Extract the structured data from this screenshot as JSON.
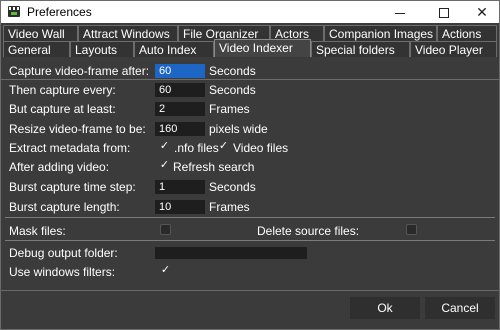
{
  "window": {
    "title": "Preferences"
  },
  "tabs_row1": [
    "Video Wall",
    "Attract Windows",
    "File Organizer",
    "Actors",
    "Companion Images",
    "Actions"
  ],
  "tabs_row2": [
    "General",
    "Layouts",
    "Auto Index",
    "Video Indexer",
    "Special folders",
    "Video Player"
  ],
  "active_tab": "Video Indexer",
  "indexer": {
    "capture_after": {
      "label": "Capture video-frame after:",
      "value": "60",
      "unit": "Seconds"
    },
    "capture_every": {
      "label": "Then capture every:",
      "value": "60",
      "unit": "Seconds"
    },
    "capture_least": {
      "label": "But capture at least:",
      "value": "2",
      "unit": "Frames"
    },
    "resize": {
      "label": "Resize video-frame to be:",
      "value": "160",
      "unit": "pixels wide"
    },
    "extract": {
      "label": "Extract metadata from:",
      "opt1": ".nfo files",
      "opt2": "Video files"
    },
    "after_adding": {
      "label": "After adding video:",
      "opt": "Refresh search"
    },
    "burst_step": {
      "label": "Burst capture time step:",
      "value": "1",
      "unit": "Seconds"
    },
    "burst_length": {
      "label": "Burst capture length:",
      "value": "10",
      "unit": "Frames"
    }
  },
  "mask_files": {
    "label": "Mask files:"
  },
  "delete_source": {
    "label": "Delete source files:"
  },
  "debug_folder": {
    "label": "Debug output folder:",
    "value": ""
  },
  "windows_filters": {
    "label": "Use windows filters:"
  },
  "buttons": {
    "ok": "Ok",
    "cancel": "Cancel"
  },
  "check_glyph": "✓"
}
